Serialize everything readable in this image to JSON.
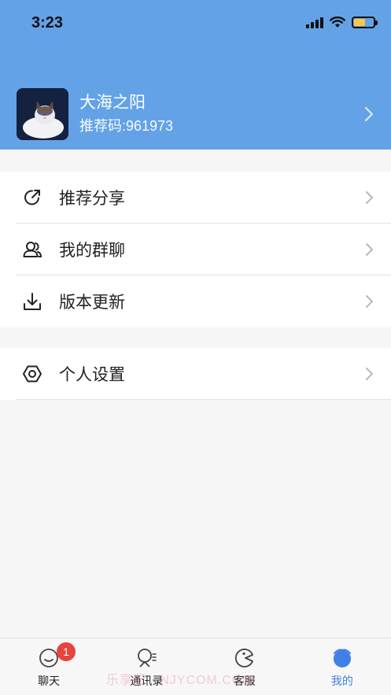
{
  "status_bar": {
    "time": "3:23"
  },
  "profile": {
    "name": "大海之阳",
    "referral": "推荐码:961973"
  },
  "menu_group_1": [
    {
      "label": "推荐分享",
      "icon": "share-icon"
    },
    {
      "label": "我的群聊",
      "icon": "group-chat-icon"
    },
    {
      "label": "版本更新",
      "icon": "download-icon"
    }
  ],
  "menu_group_2": [
    {
      "label": "个人设置",
      "icon": "settings-icon"
    }
  ],
  "tabbar": {
    "tabs": [
      {
        "label": "聊天",
        "icon": "chat-icon",
        "badge": "1"
      },
      {
        "label": "通讯录",
        "icon": "contacts-icon"
      },
      {
        "label": "客服",
        "icon": "customer-service-icon"
      },
      {
        "label": "我的",
        "icon": "profile-icon"
      }
    ],
    "active_tab": "我的"
  },
  "watermark": "乐享汇 · NJYCOM.COM",
  "colors": {
    "header": "#63a2e6",
    "active_tab": "#3f7fe6",
    "badge": "#e8443c"
  }
}
